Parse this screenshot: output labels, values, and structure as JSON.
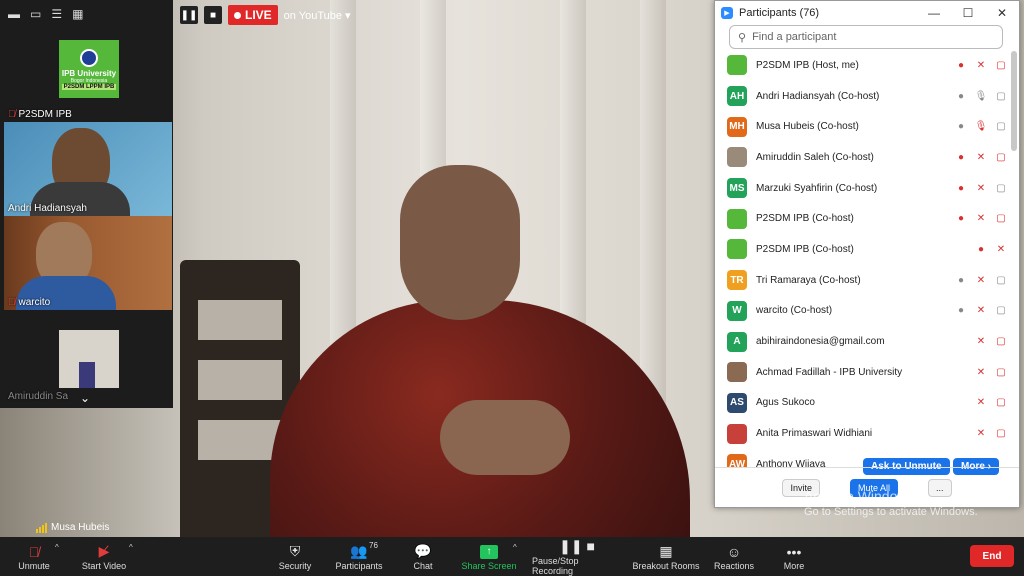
{
  "window": {
    "title": "Participants (76)"
  },
  "live": {
    "badge": "LIVE",
    "target": "on YouTube",
    "pause_icon": "pause-icon",
    "stop_icon": "stop-icon"
  },
  "gallery": {
    "tiles": [
      {
        "name": "P2SDM IPB",
        "logo_line1": "IPB University",
        "logo_line2": "Bogor Indonesia",
        "logo_line3": "P2SDM LPPM IPB"
      },
      {
        "name": "Andri Hadiansyah"
      },
      {
        "name": "warcito"
      },
      {
        "name": "Amiruddin Sa"
      }
    ]
  },
  "active_speaker": {
    "name": "Musa Hubeis"
  },
  "participants_panel": {
    "title": "Participants (76)",
    "search_placeholder": "Find a participant",
    "rows": [
      {
        "name": "P2SDM IPB (Host, me)",
        "initials": "",
        "avatar_color": "#55b83a",
        "avatar_type": "logo"
      },
      {
        "name": "Andri Hadiansyah (Co-host)",
        "initials": "AH",
        "avatar_color": "#23a35a",
        "avatar_type": "initials"
      },
      {
        "name": "Musa Hubeis (Co-host)",
        "initials": "MH",
        "avatar_color": "#e06a1a",
        "avatar_type": "initials"
      },
      {
        "name": "Amiruddin Saleh (Co-host)",
        "initials": "",
        "avatar_color": "#9a8a7a",
        "avatar_type": "photo"
      },
      {
        "name": "Marzuki Syahfirin (Co-host)",
        "initials": "MS",
        "avatar_color": "#23a35a",
        "avatar_type": "initials"
      },
      {
        "name": "P2SDM IPB (Co-host)",
        "initials": "",
        "avatar_color": "#55b83a",
        "avatar_type": "logo"
      },
      {
        "name": "P2SDM IPB (Co-host)",
        "initials": "",
        "avatar_color": "#55b83a",
        "avatar_type": "logo"
      },
      {
        "name": "Tri Ramaraya (Co-host)",
        "initials": "TR",
        "avatar_color": "#f0a020",
        "avatar_type": "initials"
      },
      {
        "name": "warcito (Co-host)",
        "initials": "W",
        "avatar_color": "#23a35a",
        "avatar_type": "initials"
      },
      {
        "name": "abihiraindonesia@gmail.com",
        "initials": "A",
        "avatar_color": "#23a35a",
        "avatar_type": "initials"
      },
      {
        "name": "Achmad Fadillah - IPB University",
        "initials": "",
        "avatar_color": "#8a6a52",
        "avatar_type": "photo"
      },
      {
        "name": "Agus Sukoco",
        "initials": "AS",
        "avatar_color": "#2e4a6e",
        "avatar_type": "initials"
      },
      {
        "name": "Anita Primaswari Widhiani",
        "initials": "",
        "avatar_color": "#c8403a",
        "avatar_type": "photo"
      },
      {
        "name": "Anthony Wijaya",
        "initials": "AW",
        "avatar_color": "#e06a1a",
        "avatar_type": "initials"
      }
    ],
    "ask_to_unmute": "Ask to Unmute",
    "more_btn": "More ›",
    "invite": "Invite",
    "mute_all": "Mute All",
    "more_options": "..."
  },
  "watermark": {
    "line1": "Activate Windows",
    "line2": "Go to Settings to activate Windows."
  },
  "toolbar": {
    "unmute": "Unmute",
    "start_video": "Start Video",
    "security": "Security",
    "participants": "Participants",
    "participants_count": "76",
    "chat": "Chat",
    "share_screen": "Share Screen",
    "pause_recording": "Pause/Stop Recording",
    "breakout_rooms": "Breakout Rooms",
    "reactions": "Reactions",
    "more": "More",
    "end": "End"
  }
}
